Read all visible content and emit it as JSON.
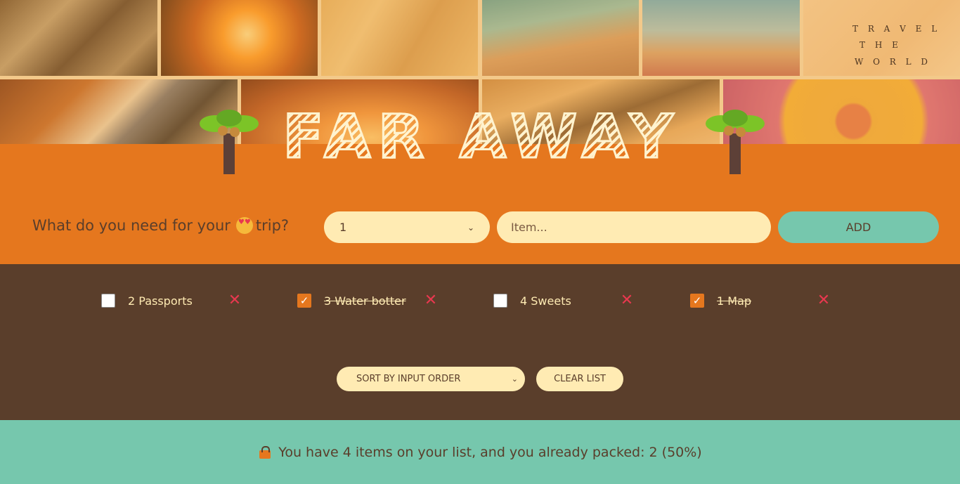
{
  "header": {
    "title": "FAR AWAY",
    "scrabble_lines": [
      "T R A V E L",
      "T H E",
      "W O R L D"
    ]
  },
  "form": {
    "question": "What do you need for your",
    "question_end": "trip?",
    "emoji": "heart-eyes-face-icon",
    "quantity_selected": "1",
    "item_placeholder": "Item...",
    "add_label": "ADD"
  },
  "items": [
    {
      "label": "2 Passports",
      "packed": false
    },
    {
      "label": "3 Water botter",
      "packed": true
    },
    {
      "label": "4 Sweets",
      "packed": false
    },
    {
      "label": "1 Map",
      "packed": true
    }
  ],
  "actions": {
    "sort_selected": "SORT BY INPUT ORDER",
    "clear_label": "CLEAR LIST"
  },
  "stats": {
    "text": "You have 4 items on your list, and you already packed: 2 (50%)",
    "total": 4,
    "packed": 2,
    "percent": 50
  },
  "colors": {
    "orange": "#e5771e",
    "brown": "#5a3e2b",
    "cream": "#ffebb3",
    "teal": "#76c7ad",
    "red_x": "#e8384f"
  }
}
